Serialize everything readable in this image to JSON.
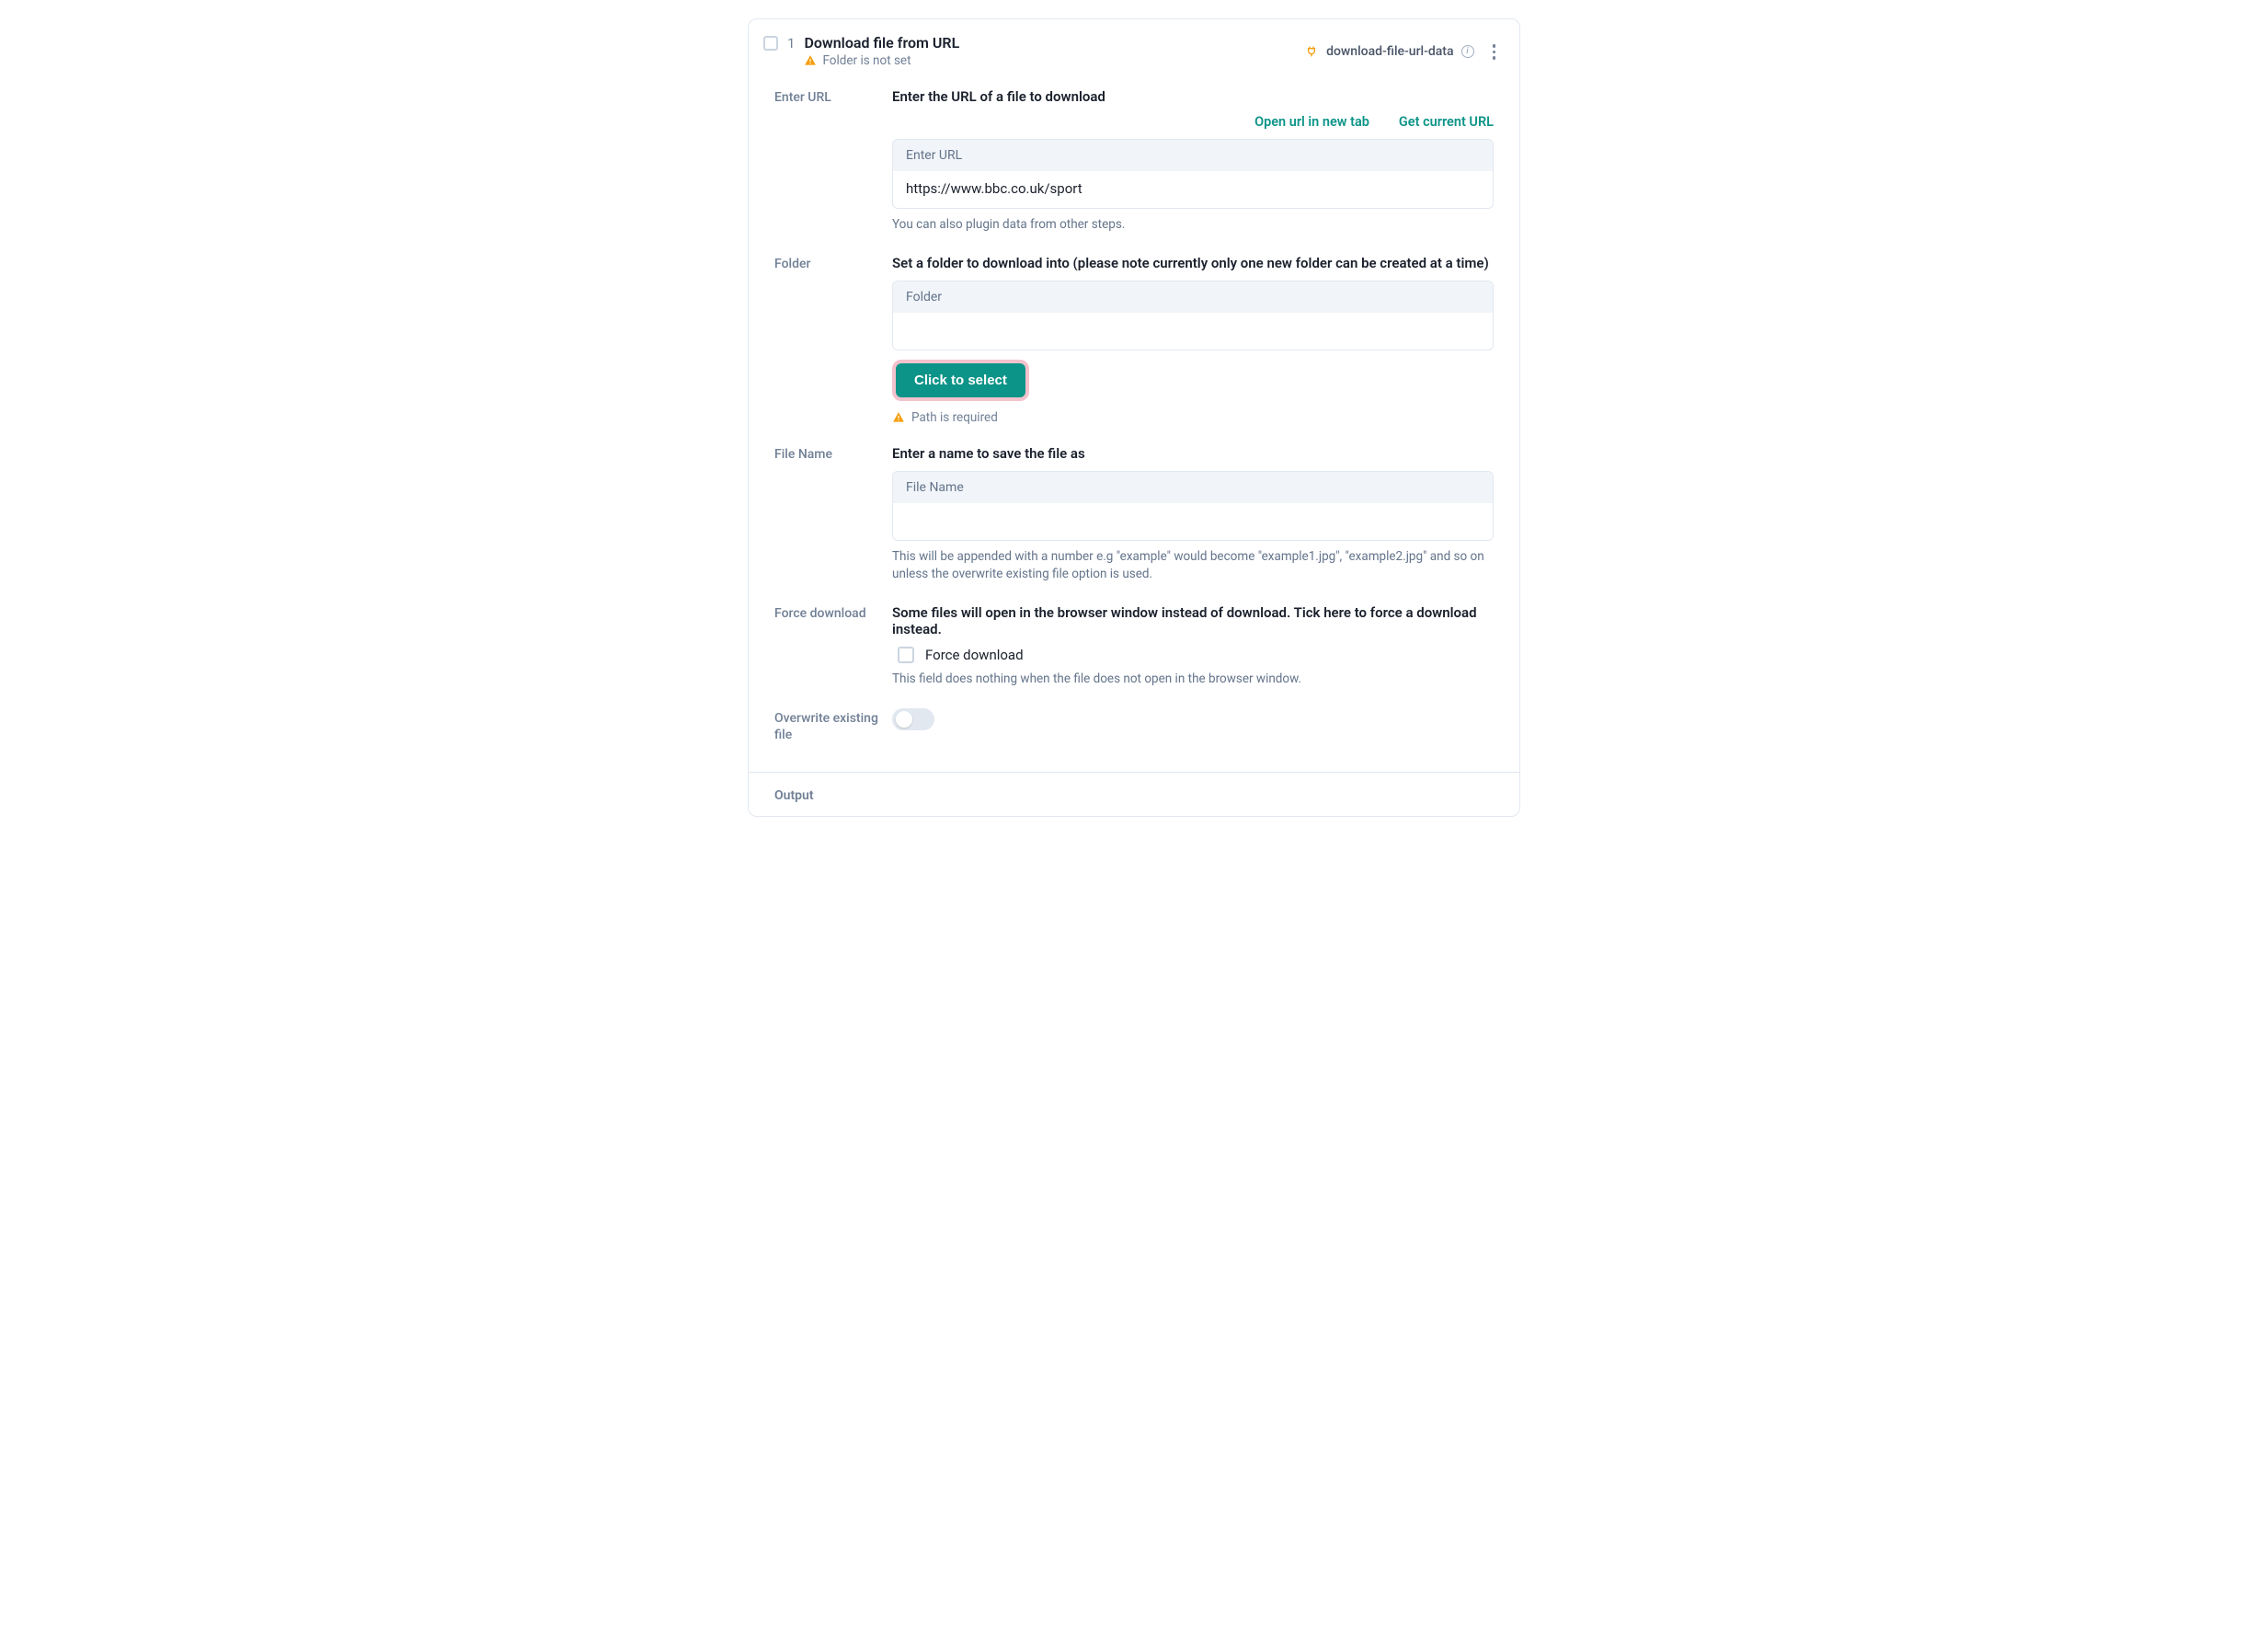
{
  "header": {
    "step_number": "1",
    "title": "Download file from URL",
    "warning": "Folder is not set",
    "plugin_name": "download-file-url-data"
  },
  "fields": {
    "enter_url": {
      "label": "Enter URL",
      "description": "Enter the URL of a file to download",
      "links": {
        "open_tab": "Open url in new tab",
        "get_current": "Get current URL"
      },
      "input_header": "Enter URL",
      "input_value": "https://www.bbc.co.uk/sport",
      "hint": "You can also plugin data from other steps."
    },
    "folder": {
      "label": "Folder",
      "description": "Set a folder to download into (please note currently only one new folder can be created at a time)",
      "input_header": "Folder",
      "input_value": "",
      "button_label": "Click to select",
      "error": "Path is required"
    },
    "file_name": {
      "label": "File Name",
      "description": "Enter a name to save the file as",
      "input_header": "File Name",
      "input_value": "",
      "hint": "This will be appended with a number e.g \"example\" would become \"example1.jpg\", \"example2.jpg\" and so on unless the overwrite existing file option is used."
    },
    "force_download": {
      "label": "Force download",
      "description": "Some files will open in the browser window instead of download. Tick here to force a download instead.",
      "check_label": "Force download",
      "hint": "This field does nothing when the file does not open in the browser window."
    },
    "overwrite": {
      "label": "Overwrite existing file"
    }
  },
  "footer": {
    "output_label": "Output"
  }
}
